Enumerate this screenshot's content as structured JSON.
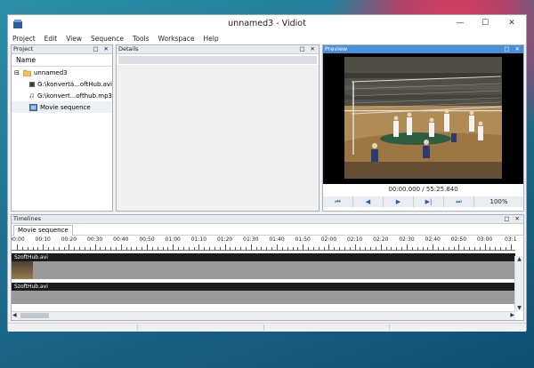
{
  "window": {
    "title": "unnamed3 - Vidiot"
  },
  "window_controls": [
    "—",
    "☐",
    "✕"
  ],
  "menu": [
    "Project",
    "Edit",
    "View",
    "Sequence",
    "Tools",
    "Workspace",
    "Help"
  ],
  "project_panel": {
    "title": "Project",
    "column": "Name",
    "root": {
      "expander": "⊟",
      "label": "unnamed3",
      "icon": "folder-icon"
    },
    "items": [
      {
        "label": "G:\\konvertá...oftHub.avi",
        "icon": "film-icon"
      },
      {
        "label": "G:\\konvert...ofthub.mp3",
        "icon": "music-note-icon"
      },
      {
        "label": "Movie sequence",
        "icon": "sequence-icon"
      }
    ]
  },
  "details_panel": {
    "title": "Details"
  },
  "preview_panel": {
    "title": "Preview",
    "time": "00:00.000 / 55:25.840",
    "zoom": "100%",
    "controls": [
      "⏮",
      "◀",
      "▶",
      "▶|",
      "⏭"
    ]
  },
  "panel_buttons": "□ ✕",
  "timelines_panel": {
    "title": "Timelines",
    "tab": "Movie sequence",
    "ruler": [
      "00:00",
      "00:10",
      "00:20",
      "00:30",
      "00:40",
      "00:50",
      "01:00",
      "01:10",
      "01:20",
      "01:30",
      "01:40",
      "01:50",
      "02:00",
      "02:10",
      "02:20",
      "02:30",
      "02:40",
      "02:50",
      "03:00",
      "03:1"
    ],
    "video_track": "SzoftHub.avi",
    "audio_track": "SzoftHub.avi"
  },
  "colors": {
    "accent": "#4a90d9",
    "transport_icon": "#2a5da8"
  }
}
